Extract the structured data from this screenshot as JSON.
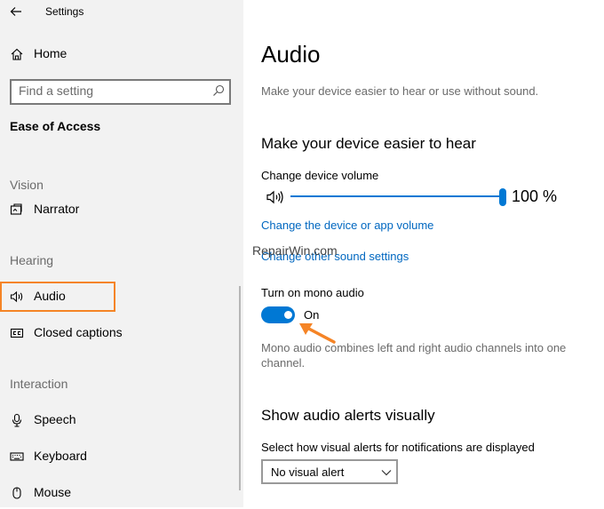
{
  "window": {
    "title": "Settings"
  },
  "sidebar": {
    "home_label": "Home",
    "search_placeholder": "Find a setting",
    "section_title": "Ease of Access",
    "groups": {
      "vision": "Vision",
      "hearing": "Hearing",
      "interaction": "Interaction"
    },
    "items": {
      "narrator": "Narrator",
      "audio": "Audio",
      "closed_captions": "Closed captions",
      "speech": "Speech",
      "keyboard": "Keyboard",
      "mouse": "Mouse"
    },
    "selected": "Audio",
    "highlight_color": "#f58426"
  },
  "main": {
    "title": "Audio",
    "description": "Make your device easier to hear or use without sound.",
    "hear_section": {
      "heading": "Make your device easier to hear",
      "volume_label": "Change device volume",
      "volume_value": "100 %",
      "volume_level": 1.0,
      "link_app_volume": "Change the device or app volume",
      "link_other_sound": "Change other sound settings"
    },
    "mono": {
      "label": "Turn on mono audio",
      "state": "On",
      "enabled": true,
      "description": "Mono audio combines left and right audio channels into one channel."
    },
    "alerts_section": {
      "heading": "Show audio alerts visually",
      "select_label": "Select how visual alerts for notifications are displayed",
      "selected_option": "No visual alert"
    }
  },
  "watermark": "RepairWin.com",
  "colors": {
    "accent": "#0078d4",
    "link": "#0067c0",
    "annotation": "#f58426"
  }
}
